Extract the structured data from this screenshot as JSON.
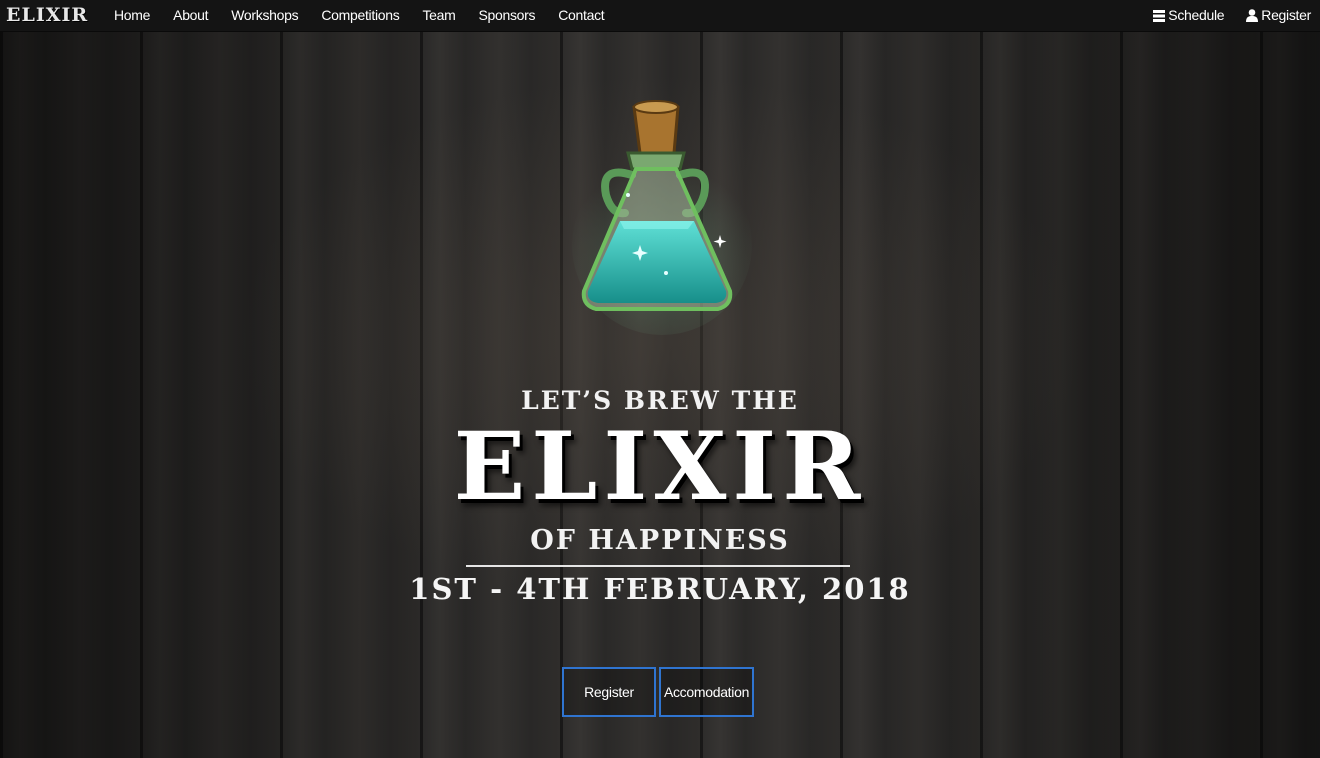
{
  "navbar": {
    "brand": "ELIXIR",
    "links": [
      "Home",
      "About",
      "Workshops",
      "Competitions",
      "Team",
      "Sponsors",
      "Contact"
    ],
    "right": [
      {
        "label": "Schedule",
        "icon": "list-icon"
      },
      {
        "label": "Register",
        "icon": "user-icon"
      }
    ]
  },
  "hero": {
    "tagline_top": "LET’S BREW THE",
    "title": "ELIXIR",
    "tagline_bottom": "OF HAPPINESS",
    "date": "1ST - 4TH FEBRUARY, 2018",
    "image": "potion-bottle-icon"
  },
  "buttons": {
    "register": "Register",
    "accommodation": "Accomodation",
    "border_color": "#2f74d0"
  }
}
